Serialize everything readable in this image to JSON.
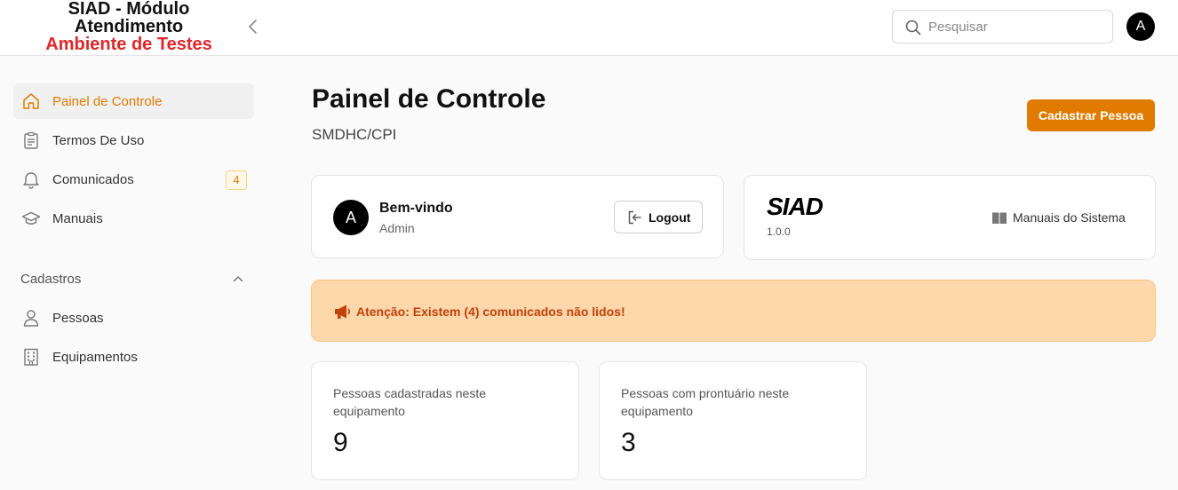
{
  "header": {
    "brand_line1": "SIAD - Módulo",
    "brand_line2": "Atendimento",
    "brand_env": "Ambiente de Testes",
    "search_placeholder": "Pesquisar",
    "avatar_initial": "A"
  },
  "sidebar": {
    "items": [
      {
        "label": "Painel de Controle",
        "icon": "home-icon",
        "active": true
      },
      {
        "label": "Termos De Uso",
        "icon": "clipboard-icon"
      },
      {
        "label": "Comunicados",
        "icon": "bell-icon",
        "badge": "4"
      },
      {
        "label": "Manuais",
        "icon": "graduation-cap-icon"
      }
    ],
    "section": {
      "label": "Cadastros",
      "items": [
        {
          "label": "Pessoas",
          "icon": "person-icon"
        },
        {
          "label": "Equipamentos",
          "icon": "building-icon"
        }
      ]
    }
  },
  "main": {
    "title": "Painel de Controle",
    "subtitle": "SMDHC/CPI",
    "primary_button": "Cadastrar Pessoa",
    "welcome": {
      "avatar_initial": "A",
      "title": "Bem-vindo",
      "role": "Admin",
      "logout_label": "Logout"
    },
    "system": {
      "logo_text": "SIAD",
      "version": "1.0.0",
      "manuals_link": "Manuais do Sistema"
    },
    "alert": "Atenção: Existem (4) comunicados não lidos!",
    "stats": [
      {
        "label": "Pessoas cadastradas neste equipamento",
        "value": "9"
      },
      {
        "label": "Pessoas com prontuário neste equipamento",
        "value": "3"
      }
    ]
  },
  "colors": {
    "accent": "#e07b00",
    "env_red": "#e0262b",
    "alert_bg": "#fed7aa",
    "alert_text": "#c2410c"
  }
}
